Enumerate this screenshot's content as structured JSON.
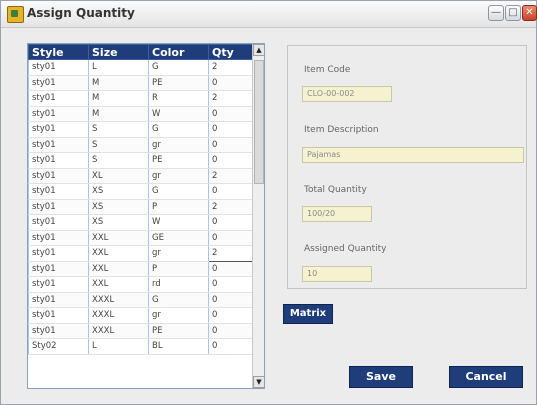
{
  "window": {
    "title": "Assign Quantity"
  },
  "grid": {
    "headers": [
      "Style",
      "Size",
      "Color",
      "Qty"
    ],
    "rows": [
      [
        "sty01",
        "L",
        "G",
        "2"
      ],
      [
        "sty01",
        "M",
        "PE",
        "0"
      ],
      [
        "sty01",
        "M",
        "R",
        "2"
      ],
      [
        "sty01",
        "M",
        "W",
        "0"
      ],
      [
        "sty01",
        "S",
        "G",
        "0"
      ],
      [
        "sty01",
        "S",
        "gr",
        "0"
      ],
      [
        "sty01",
        "S",
        "PE",
        "0"
      ],
      [
        "sty01",
        "XL",
        "gr",
        "2"
      ],
      [
        "sty01",
        "XS",
        "G",
        "0"
      ],
      [
        "sty01",
        "XS",
        "P",
        "2"
      ],
      [
        "sty01",
        "XS",
        "W",
        "0"
      ],
      [
        "sty01",
        "XXL",
        "GE",
        "0"
      ],
      [
        "sty01",
        "XXL",
        "gr",
        "2"
      ],
      [
        "sty01",
        "XXL",
        "P",
        "0"
      ],
      [
        "sty01",
        "XXL",
        "rd",
        "0"
      ],
      [
        "sty01",
        "XXXL",
        "G",
        "0"
      ],
      [
        "sty01",
        "XXXL",
        "gr",
        "0"
      ],
      [
        "sty01",
        "XXXL",
        "PE",
        "0"
      ],
      [
        "Sty02",
        "L",
        "BL",
        "0"
      ]
    ]
  },
  "form": {
    "item_code_label": "Item Code",
    "item_code_value": "CLO-00-002",
    "item_description_label": "Item Description",
    "item_description_value": "Pajamas",
    "total_quantity_label": "Total Quantity",
    "total_quantity_value": "100/20",
    "assigned_quantity_label": "Assigned Quantity",
    "assigned_quantity_value": "10"
  },
  "buttons": {
    "matrix": "Matrix",
    "save": "Save",
    "cancel": "Cancel"
  },
  "icons": {
    "app": "app-icon",
    "minimize": "minimize-icon",
    "maximize": "maximize-icon",
    "close": "close-icon"
  }
}
